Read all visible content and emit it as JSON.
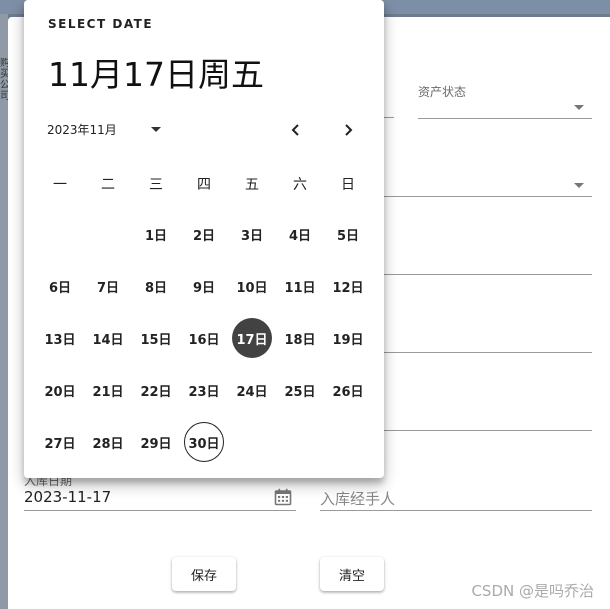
{
  "left_sliver": {
    "chars": [
      "购",
      "买",
      "公",
      "司"
    ]
  },
  "form": {
    "asset_status_label": "资产状态",
    "stock_in_date_label": "入库日期",
    "stock_in_date_value": "2023-11-17",
    "handler_placeholder": "入库经手人"
  },
  "buttons": {
    "save": "保存",
    "clear": "清空"
  },
  "watermark": "CSDN @是吗乔治",
  "picker": {
    "header_label": "SELECT DATE",
    "headline": "11月17日周五",
    "month_label": "2023年11月",
    "prev_icon": "chevron-left-icon",
    "next_icon": "chevron-right-icon",
    "weekdays": [
      "一",
      "二",
      "三",
      "四",
      "五",
      "六",
      "日"
    ],
    "weeks": [
      [
        "",
        "",
        "1日",
        "2日",
        "3日",
        "4日",
        "5日"
      ],
      [
        "6日",
        "7日",
        "8日",
        "9日",
        "10日",
        "11日",
        "12日"
      ],
      [
        "13日",
        "14日",
        "15日",
        "16日",
        "17日",
        "18日",
        "19日"
      ],
      [
        "20日",
        "21日",
        "22日",
        "23日",
        "24日",
        "25日",
        "26日"
      ],
      [
        "27日",
        "28日",
        "29日",
        "30日",
        "",
        "",
        ""
      ]
    ],
    "selected_day": "17日",
    "today_day": "30日",
    "selected_color": "#424242"
  }
}
